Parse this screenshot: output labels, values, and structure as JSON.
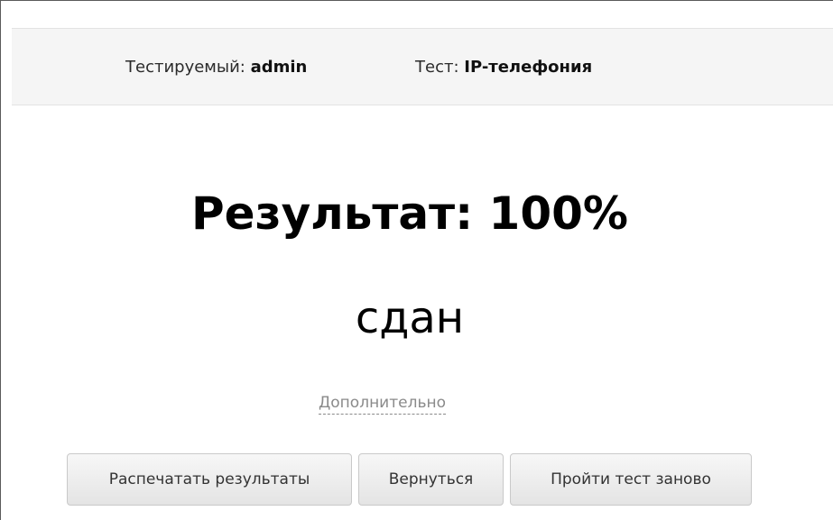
{
  "info_bar": {
    "user_label": "Тестируемый:",
    "user_value": "admin",
    "test_label": "Тест:",
    "test_value": "IP-телефония"
  },
  "result": {
    "title": "Результат: 100%",
    "status": "сдан",
    "more_link": "Дополнительно"
  },
  "actions": {
    "print_label": "Распечатать результаты",
    "back_label": "Вернуться",
    "retry_label": "Пройти тест заново"
  }
}
